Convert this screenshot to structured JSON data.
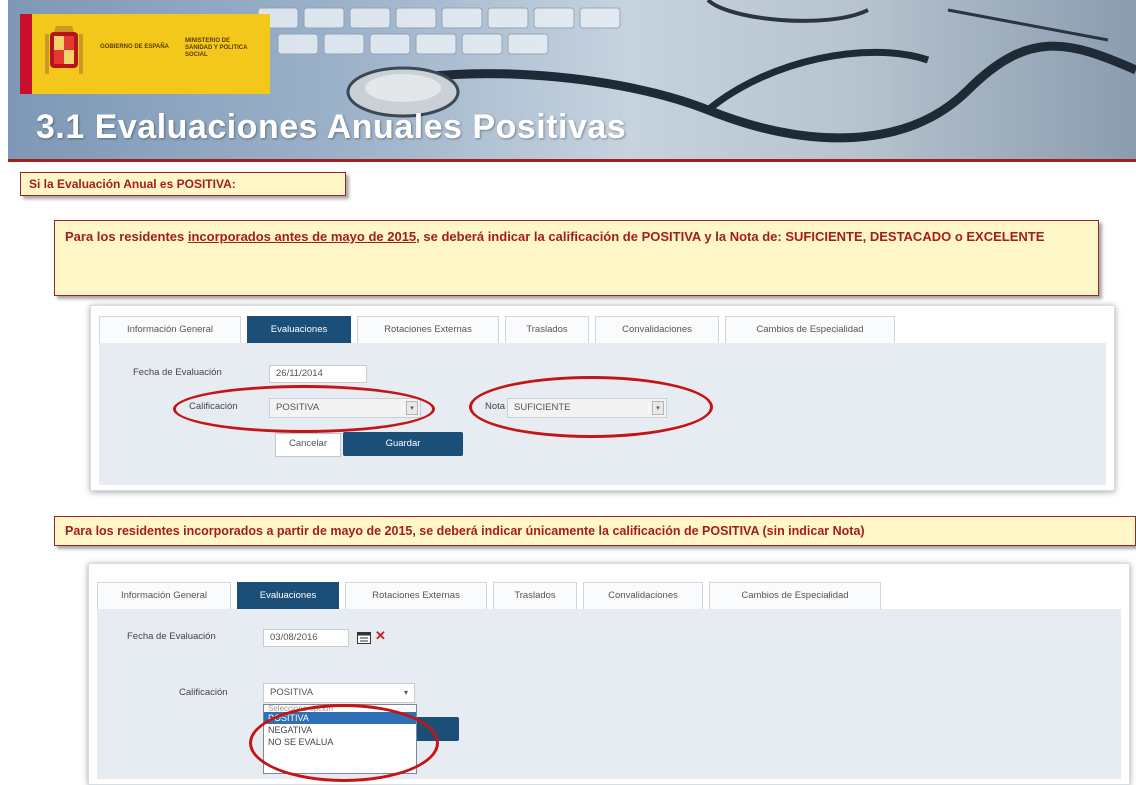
{
  "banner": {
    "title": "3.1 Evaluaciones Anuales Positivas",
    "logo_left": "GOBIERNO DE ESPAÑA",
    "logo_right": "MINISTERIO DE SANIDAD Y POLITICA SOCIAL"
  },
  "callouts": {
    "positive": "Si la Evaluación Anual es POSITIVA:",
    "before_pre": "Para los residentes ",
    "before_link": "incorporados antes de mayo de 2015",
    "before_post": ", se deberá indicar la calificación de POSITIVA y la Nota de: SUFICIENTE, DESTACADO o EXCELENTE",
    "after": "Para los residentes incorporados a partir de mayo de 2015, se deberá indicar únicamente la calificación de POSITIVA (sin indicar Nota)"
  },
  "form1": {
    "tabs": [
      "Información General",
      "Evaluaciones",
      "Rotaciones Externas",
      "Traslados",
      "Convalidaciones",
      "Cambios de Especialidad"
    ],
    "fecha_label": "Fecha de Evaluación",
    "fecha_value": "26/11/2014",
    "calificacion_label": "Calificación",
    "calificacion_value": "POSITIVA",
    "nota_label": "Nota",
    "nota_value": "SUFICIENTE",
    "cancel_label": "Cancelar",
    "save_label": "Guardar"
  },
  "form2": {
    "tabs": [
      "Información General",
      "Evaluaciones",
      "Rotaciones Externas",
      "Traslados",
      "Convalidaciones",
      "Cambios de Especialidad"
    ],
    "fecha_label": "Fecha de Evaluación",
    "fecha_value": "03/08/2016",
    "calificacion_label": "Calificación",
    "calificacion_value": "POSITIVA",
    "options": [
      "Seleccione opción",
      "POSITIVA",
      "NEGATIVA",
      "NO SE EVALUA"
    ],
    "calendar_icon": "calendar-icon",
    "clear_icon": "clear-x-icon"
  },
  "colors": {
    "accent": "#1c4f78",
    "callout_bg": "#fff7c7",
    "callout_text": "#a41d1d",
    "highlight_ellipse": "#c41414"
  }
}
